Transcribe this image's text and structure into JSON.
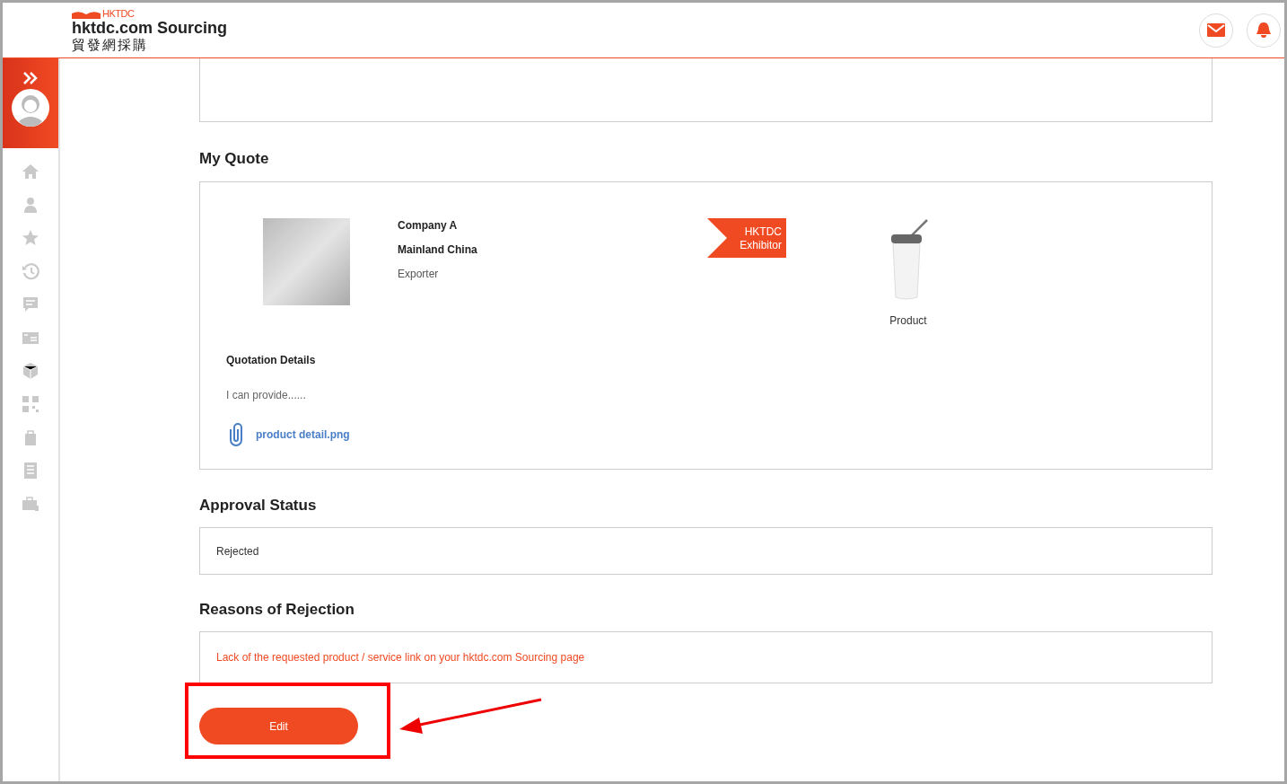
{
  "header": {
    "logo_mark": "HKTDC",
    "title": "hktdc.com Sourcing",
    "subtitle": "貿發網採購"
  },
  "my_quote": {
    "heading": "My Quote",
    "company": "Company A",
    "region": "Mainland China",
    "business_type": "Exporter",
    "badge": [
      "HKTDC",
      "Exhibitor"
    ],
    "product_label": "Product",
    "details_heading": "Quotation Details",
    "details_text": "I can provide......",
    "attachment": "product detail.png"
  },
  "approval": {
    "heading": "Approval Status",
    "value": "Rejected"
  },
  "rejection": {
    "heading": "Reasons of Rejection",
    "value": "Lack of the requested product / service link on your hktdc.com Sourcing page"
  },
  "edit_button": "Edit",
  "annotations": [
    {
      "kind": "rectangle"
    },
    {
      "kind": "arrow"
    }
  ]
}
